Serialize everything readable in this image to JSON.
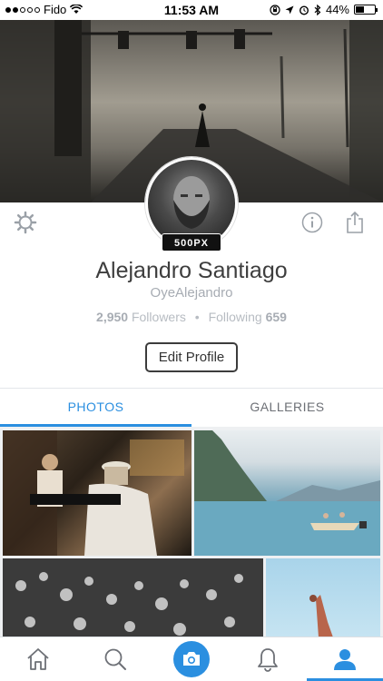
{
  "status_bar": {
    "carrier": "Fido",
    "time": "11:53 AM",
    "battery": "44%",
    "battery_level": 0.44
  },
  "profile": {
    "badge": "500PX",
    "name": "Alejandro Santiago",
    "username": "OyeAlejandro",
    "followers_count": "2,950",
    "followers_label": "Followers",
    "following_label": "Following",
    "following_count": "659",
    "edit_label": "Edit Profile"
  },
  "tabs": [
    {
      "label": "PHOTOS",
      "active": true
    },
    {
      "label": "GALLERIES",
      "active": false
    }
  ],
  "tabbar": {
    "items": [
      "home-icon",
      "search-icon",
      "camera-icon",
      "bell-icon",
      "profile-icon"
    ],
    "active": "profile-icon"
  },
  "colors": {
    "accent": "#2b8fe0",
    "muted_text": "#a7acb3",
    "name_text": "#3e3e3e"
  }
}
